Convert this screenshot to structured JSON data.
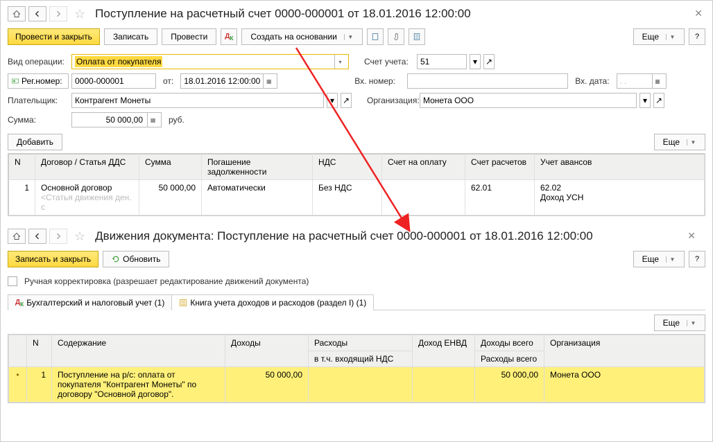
{
  "upper": {
    "title": "Поступление на расчетный счет 0000-000001 от 18.01.2016 12:00:00",
    "post_close": "Провести и закрыть",
    "write": "Записать",
    "post": "Провести",
    "create_based": "Создать на основании",
    "more": "Еще",
    "help": "?",
    "op_type_lbl": "Вид операции:",
    "op_type_val": "Оплата от покупателя",
    "acct_lbl": "Счет учета:",
    "acct_val": "51",
    "regnum_lbl": "Рег.номер:",
    "regnum_val": "0000-000001",
    "from_lbl": "от:",
    "from_val": "18.01.2016 12:00:00",
    "in_num_lbl": "Вх. номер:",
    "in_date_lbl": "Вх. дата:",
    "in_date_val": ".  .",
    "payer_lbl": "Плательщик:",
    "payer_val": "Контрагент Монеты",
    "org_lbl": "Организация:",
    "org_val": "Монета ООО",
    "sum_lbl": "Сумма:",
    "sum_val": "50 000,00",
    "sum_cur": "руб.",
    "add": "Добавить",
    "cols": {
      "n": "N",
      "contract": "Договор / Статья ДДС",
      "sum": "Сумма",
      "repay": "Погашение задолженности",
      "vat": "НДС",
      "inv": "Счет на оплату",
      "acct_pay": "Счет расчетов",
      "acct_adv": "Учет авансов"
    },
    "row": {
      "n": "1",
      "contract": "Основной договор",
      "sub": "<Статья движения ден. с",
      "sum": "50 000,00",
      "repay": "Автоматически",
      "vat": "Без НДС",
      "acct_pay": "62.01",
      "acct_adv": "62.02",
      "adv_sub": "Доход УСН"
    }
  },
  "lower": {
    "title": "Движения документа: Поступление на расчетный счет 0000-000001 от 18.01.2016 12:00:00",
    "save_close": "Записать и закрыть",
    "refresh": "Обновить",
    "more": "Еще",
    "help": "?",
    "manual": "Ручная корректировка (разрешает редактирование движений документа)",
    "tab1": "Бухгалтерский и налоговый учет (1)",
    "tab2": "Книга учета доходов и расходов (раздел I) (1)",
    "cols": {
      "n": "N",
      "content": "Содержание",
      "income": "Доходы",
      "expense": "Расходы",
      "expense_sub": "в т.ч. входящий НДС",
      "envd": "Доход ЕНВД",
      "income_total": "Доходы всего",
      "expense_total": "Расходы всего",
      "org": "Организация"
    },
    "row": {
      "n": "1",
      "content": "Поступление на р/с: оплата от покупателя \"Контрагент Монеты\" по договору \"Основной договор\".",
      "income": "50 000,00",
      "income_total": "50 000,00",
      "org": "Монета ООО"
    }
  }
}
